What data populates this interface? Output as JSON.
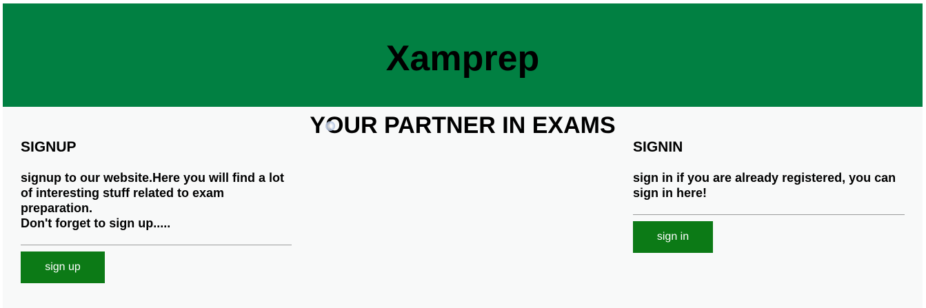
{
  "header": {
    "brand": "Xamprep"
  },
  "main": {
    "tagline": "YOUR PARTNER IN EXAMS",
    "signup": {
      "title": "SIGNUP",
      "text_line1": "signup to our website.Here you will find a lot of interesting stuff related to exam preparation.",
      "text_line2": "Don't forget to sign up.....",
      "button_label": "sign up"
    },
    "signin": {
      "title": "SIGNIN",
      "text": "sign in if you are already registered, you can sign in here!",
      "button_label": "sign in"
    }
  },
  "colors": {
    "header_bg": "#018042",
    "button_bg": "#0c7a16",
    "page_bg": "#f8f9f9"
  }
}
